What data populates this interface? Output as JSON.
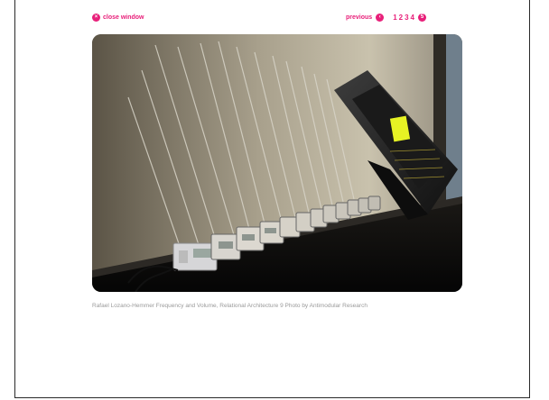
{
  "nav": {
    "close_label": "close window",
    "close_icon": "x",
    "previous_label": "previous",
    "pages": [
      "1",
      "2",
      "3",
      "4"
    ],
    "next_icon": "5"
  },
  "photo": {
    "alt": "Rafael Lozano-Hemmer Frequency and Volume, Relational Architecture 9 Photo by Antimodular Research"
  },
  "caption": "Rafael Lozano-Hemmer Frequency and Volume, Relational Architecture 9 Photo by Antimodular Research",
  "colors": {
    "accent": "#e8207a",
    "caption": "#9a9a9a"
  }
}
